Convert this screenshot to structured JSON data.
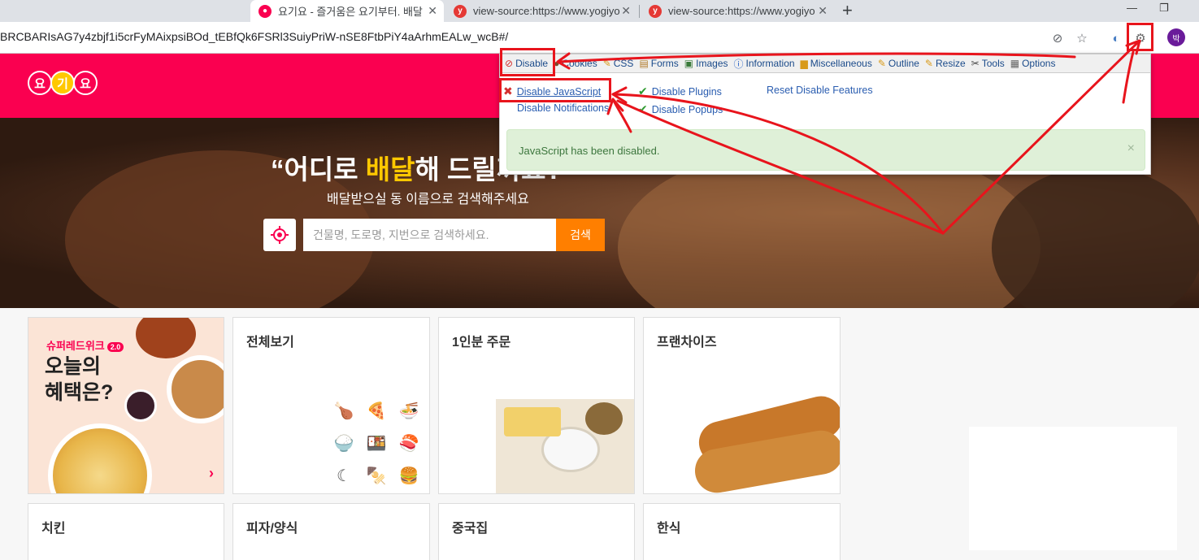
{
  "browser": {
    "tabs": [
      {
        "title": "요기요 - 즐거움은 요기부터. 배달",
        "active": true
      },
      {
        "title": "view-source:https://www.yogiyo",
        "active": false
      },
      {
        "title": "view-source:https://www.yogiyo",
        "active": false
      }
    ],
    "new_tab_label": "+",
    "url": "BRCBARIsAG7y4zbjf1i5crFyMAixpsiBOd_tEBfQk6FSRl3SuiyPriW-nSE8FtbPiY4aArhmEALw_wcB#/",
    "profile_initial": "박"
  },
  "extension": {
    "menu": [
      {
        "label": "Disable",
        "icon": "no-entry-icon"
      },
      {
        "label": "Cookies",
        "icon": "cookie-icon"
      },
      {
        "label": "CSS",
        "icon": "pencil-icon"
      },
      {
        "label": "Forms",
        "icon": "form-icon"
      },
      {
        "label": "Images",
        "icon": "image-icon"
      },
      {
        "label": "Information",
        "icon": "info-icon"
      },
      {
        "label": "Miscellaneous",
        "icon": "folder-icon"
      },
      {
        "label": "Outline",
        "icon": "pencil-icon"
      },
      {
        "label": "Resize",
        "icon": "pencil-icon"
      },
      {
        "label": "Tools",
        "icon": "tools-icon"
      },
      {
        "label": "Options",
        "icon": "options-icon"
      }
    ],
    "disable_js": "Disable JavaScript",
    "disable_notifications": "Disable Notifications",
    "disable_plugins": "Disable Plugins",
    "disable_popups": "Disable Popups",
    "reset": "Reset Disable Features",
    "alert": "JavaScript has been disabled.",
    "alert_close": "×"
  },
  "site": {
    "logo": [
      "요",
      "기",
      "요"
    ],
    "headline_pre": "“어디로 ",
    "headline_hl": "배달",
    "headline_post": "해 드릴까요?”",
    "subline": "배달받으실 동 이름으로 검색해주세요",
    "search_placeholder": "건물명, 도로명, 지번으로 검색하세요.",
    "search_button": "검색",
    "promo": {
      "tag": "슈퍼레드위크",
      "badge": "2.0",
      "line1": "오늘의",
      "line2": "혜택은?",
      "arrow": "›"
    },
    "categories": [
      "전체보기",
      "1인분 주문",
      "프랜차이즈",
      "치킨",
      "피자/양식",
      "중국집",
      "한식"
    ]
  },
  "colors": {
    "brand": "#fa0050",
    "accent": "#ffc800",
    "search_button": "#ff7f00",
    "annotation": "#e8141c",
    "alert_bg": "#dff0d8"
  }
}
